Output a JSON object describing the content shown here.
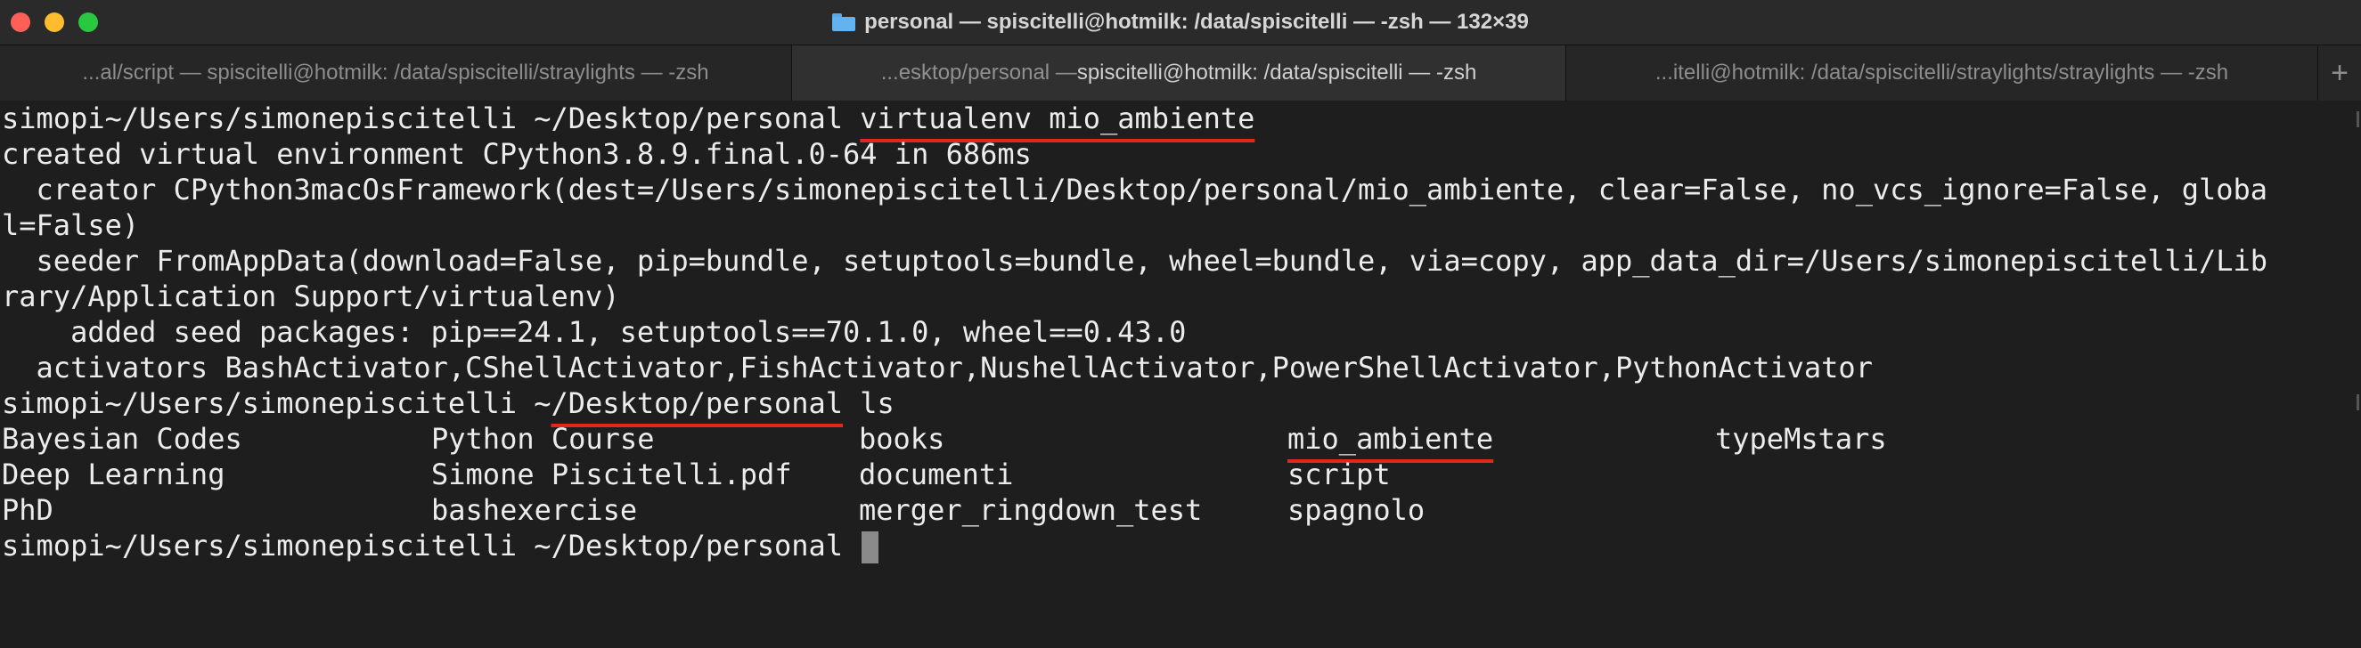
{
  "window": {
    "title": "personal — spiscitelli@hotmilk: /data/spiscitelli — -zsh — 132×39"
  },
  "tabs": [
    {
      "label": "...al/script — spiscitelli@hotmilk: /data/spiscitelli/straylights — -zsh"
    },
    {
      "label_dim": "...esktop/personal — ",
      "label_bright": "spiscitelli@hotmilk: /data/spiscitelli — -zsh"
    },
    {
      "label": "...itelli@hotmilk: /data/spiscitelli/straylights/straylights — -zsh"
    }
  ],
  "new_tab": "+",
  "terminal": {
    "prompt1": "simopi~/Users/simonepiscitelli ~/Desktop/personal ",
    "cmd1": "virtualenv mio_ambiente",
    "out1": "created virtual environment CPython3.8.9.final.0-64 in 686ms",
    "out2": "  creator CPython3macOsFramework(dest=/Users/simonepiscitelli/Desktop/personal/mio_ambiente, clear=False, no_vcs_ignore=False, globa",
    "out3": "l=False)",
    "out4": "  seeder FromAppData(download=False, pip=bundle, setuptools=bundle, wheel=bundle, via=copy, app_data_dir=/Users/simonepiscitelli/Lib",
    "out5": "rary/Application Support/virtualenv)",
    "out6": "    added seed packages: pip==24.1, setuptools==70.1.0, wheel==0.43.0",
    "out7": "  activators BashActivator,CShellActivator,FishActivator,NushellActivator,PowerShellActivator,PythonActivator",
    "prompt2_a": "simopi~/Users/simonepiscitelli ~",
    "prompt2_b": "/Desktop/personal",
    "cmd2": " ls",
    "ls": [
      [
        "Bayesian Codes",
        "Python Course",
        "books",
        "mio_ambiente",
        "typeMstars"
      ],
      [
        "Deep Learning",
        "Simone Piscitelli.pdf",
        "documenti",
        "script",
        ""
      ],
      [
        "PhD",
        "bashexercise",
        "merger_ringdown_test",
        "spagnolo",
        ""
      ]
    ],
    "prompt3": "simopi~/Users/simonepiscitelli ~/Desktop/personal "
  }
}
